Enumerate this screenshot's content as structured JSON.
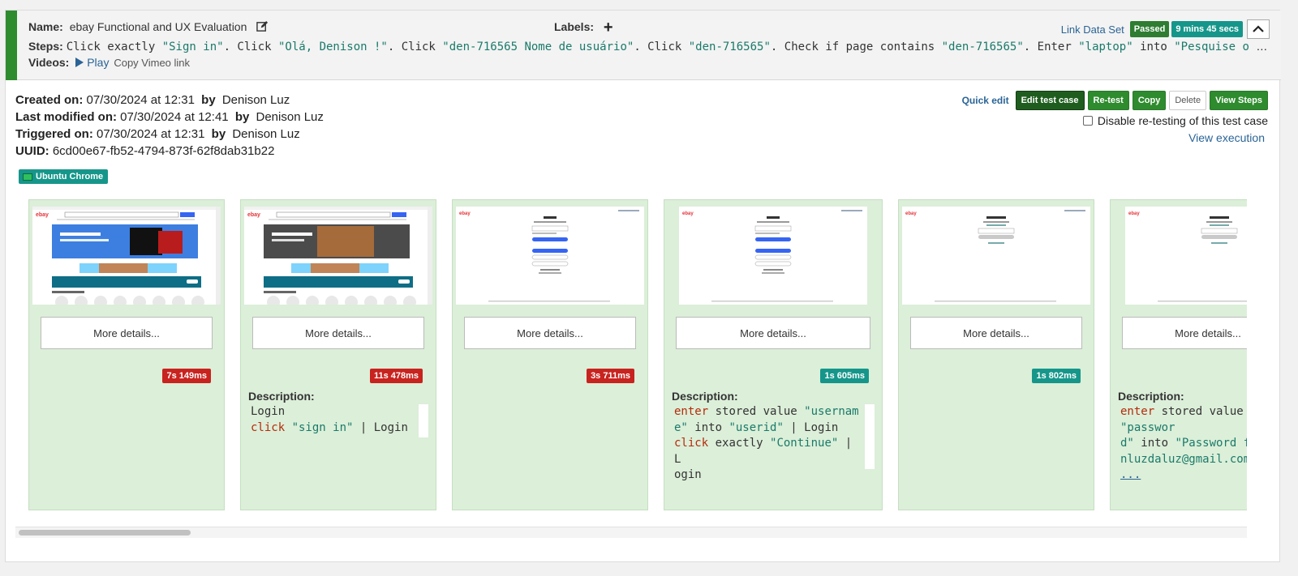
{
  "header": {
    "name_label": "Name:",
    "name_value": "ebay Functional and UX Evaluation",
    "labels_label": "Labels:",
    "labels_add": "+",
    "link_data_set": "Link Data Set",
    "status_badge": "Passed",
    "duration_badge": "9 mins 45 secs",
    "steps_label": "Steps:",
    "steps_parts": [
      {
        "t": "Click exactly ",
        "s": false
      },
      {
        "t": "\"Sign in\"",
        "s": true
      },
      {
        "t": ". Click ",
        "s": false
      },
      {
        "t": "\"Olá, Denison !\"",
        "s": true
      },
      {
        "t": ". Click ",
        "s": false
      },
      {
        "t": "\"den-716565 Nome de usuário\"",
        "s": true
      },
      {
        "t": ". Click ",
        "s": false
      },
      {
        "t": "\"den-716565\"",
        "s": true
      },
      {
        "t": ". Check if page contains ",
        "s": false
      },
      {
        "t": "\"den-716565\"",
        "s": true
      },
      {
        "t": ". Enter ",
        "s": false
      },
      {
        "t": "\"laptop\"",
        "s": true
      },
      {
        "t": " into ",
        "s": false
      },
      {
        "t": "\"Pesquise o qualquer coisa\"",
        "s": true
      }
    ],
    "videos_label": "Videos:",
    "play_label": "Play",
    "copy_vimeo_label": "Copy Vimeo link",
    "colors": {
      "pass_stripe": "#2e8b2e",
      "passed": "#2e7d32",
      "teal": "#16968a",
      "link": "#2a6496"
    }
  },
  "meta": {
    "created_label": "Created on:",
    "created_value": "07/30/2024 at 12:31",
    "created_by": "Denison Luz",
    "modified_label": "Last modified on:",
    "modified_value": "07/30/2024 at 12:41",
    "modified_by": "Denison Luz",
    "triggered_label": "Triggered on:",
    "triggered_value": "07/30/2024 at 12:31",
    "triggered_by": "Denison Luz",
    "by_label": "by",
    "uuid_label": "UUID:",
    "uuid_value": "6cd00e67-fb52-4794-873f-62f8dab31b22",
    "environment": "Ubuntu Chrome"
  },
  "actions": {
    "quick_edit": "Quick edit",
    "edit_test_case": "Edit test case",
    "retest": "Re-test",
    "copy": "Copy",
    "delete": "Delete",
    "view_steps": "View Steps",
    "disable_retest": "Disable re-testing of this test case",
    "view_execution": "View execution"
  },
  "steps": [
    {
      "more": "More details...",
      "time": "7s 149ms",
      "status": "red",
      "thumb": "home1",
      "has_desc": false
    },
    {
      "more": "More details...",
      "time": "11s 478ms",
      "status": "red",
      "thumb": "home2",
      "has_desc": true,
      "desc_label": "Description:",
      "desc_lines": [
        [
          {
            "t": "Login",
            "c": "n"
          }
        ],
        [
          {
            "t": "click ",
            "c": "k"
          },
          {
            "t": "\"sign in\"",
            "c": "s"
          },
          {
            "t": " | Login",
            "c": "n"
          }
        ]
      ]
    },
    {
      "more": "More details...",
      "time": "3s 711ms",
      "status": "red",
      "thumb": "login",
      "has_desc": false
    },
    {
      "more": "More details...",
      "time": "1s 605ms",
      "status": "teal",
      "thumb": "login",
      "has_desc": true,
      "desc_label": "Description:",
      "desc_lines": [
        [
          {
            "t": "enter",
            "c": "k"
          },
          {
            "t": " stored value ",
            "c": "n"
          },
          {
            "t": "\"usernam",
            "c": "s"
          }
        ],
        [
          {
            "t": "e\"",
            "c": "s"
          },
          {
            "t": " into ",
            "c": "n"
          },
          {
            "t": "\"userid\"",
            "c": "s"
          },
          {
            "t": " | Login",
            "c": "n"
          }
        ],
        [
          {
            "t": "click",
            "c": "k"
          },
          {
            "t": " exactly ",
            "c": "n"
          },
          {
            "t": "\"Continue\"",
            "c": "s"
          },
          {
            "t": " | L",
            "c": "n"
          }
        ],
        [
          {
            "t": "ogin",
            "c": "n"
          }
        ]
      ]
    },
    {
      "more": "More details...",
      "time": "1s 802ms",
      "status": "teal",
      "thumb": "welcome",
      "has_desc": false
    },
    {
      "more": "More details...",
      "time": "",
      "status": "teal",
      "thumb": "welcome",
      "has_desc": true,
      "desc_label": "Description:",
      "desc_lines": [
        [
          {
            "t": "enter",
            "c": "k"
          },
          {
            "t": " stored value ",
            "c": "n"
          },
          {
            "t": "\"passwor",
            "c": "s"
          }
        ],
        [
          {
            "t": "d\"",
            "c": "s"
          },
          {
            "t": " into ",
            "c": "n"
          },
          {
            "t": "\"Password fo",
            "c": "s"
          }
        ],
        [
          {
            "t": "nluzdaluz@gmail.com\"",
            "c": "s"
          }
        ],
        [
          {
            "t": "...",
            "c": "u"
          }
        ]
      ]
    }
  ]
}
